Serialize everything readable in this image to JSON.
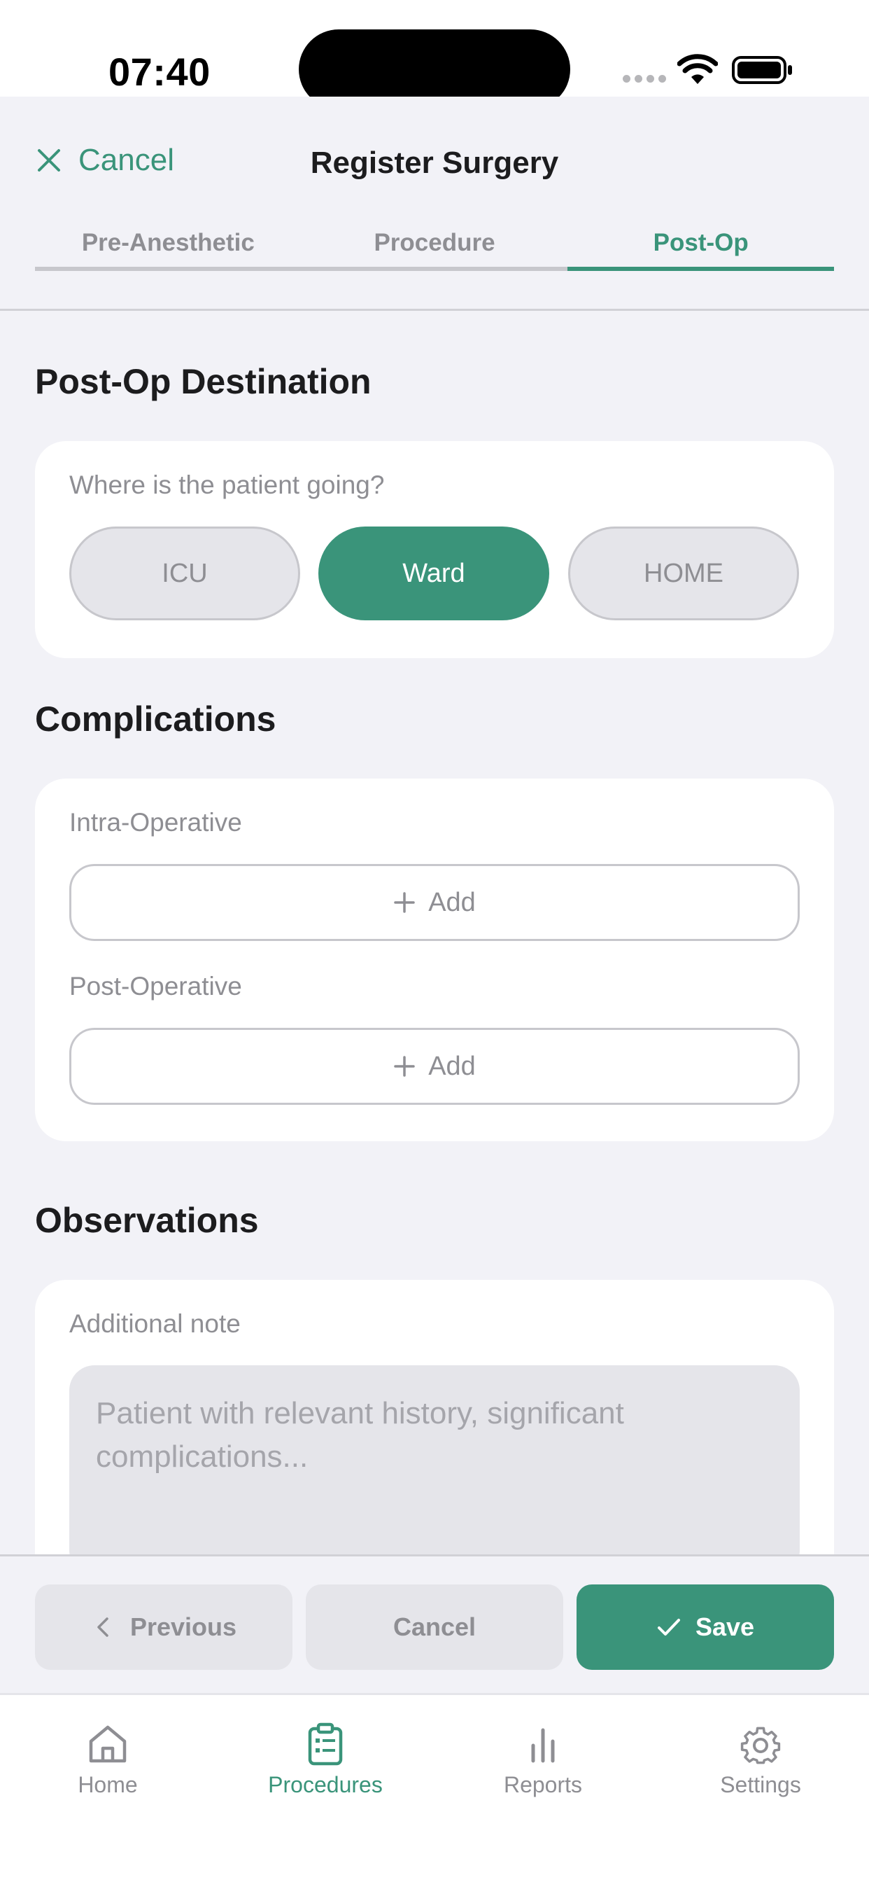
{
  "status_bar": {
    "time": "07:40"
  },
  "header": {
    "cancel_label": "Cancel",
    "title": "Register Surgery",
    "tabs": [
      {
        "label": "Pre-Anesthetic",
        "active": false
      },
      {
        "label": "Procedure",
        "active": false
      },
      {
        "label": "Post-Op",
        "active": true
      }
    ]
  },
  "destination": {
    "section_title": "Post-Op Destination",
    "question": "Where is the patient going?",
    "options": [
      {
        "label": "ICU",
        "selected": false
      },
      {
        "label": "Ward",
        "selected": true
      },
      {
        "label": "HOME",
        "selected": false
      }
    ]
  },
  "complications": {
    "section_title": "Complications",
    "intra_label": "Intra-Operative",
    "intra_add": "Add",
    "post_label": "Post-Operative",
    "post_add": "Add"
  },
  "observations": {
    "section_title": "Observations",
    "note_label": "Additional note",
    "note_placeholder": "Patient with relevant history, significant complications..."
  },
  "actions": {
    "previous": "Previous",
    "cancel": "Cancel",
    "save": "Save"
  },
  "tab_bar": {
    "items": [
      {
        "label": "Home",
        "icon": "home-icon",
        "active": false
      },
      {
        "label": "Procedures",
        "icon": "clipboard-icon",
        "active": true
      },
      {
        "label": "Reports",
        "icon": "bar-chart-icon",
        "active": false
      },
      {
        "label": "Settings",
        "icon": "gear-icon",
        "active": false
      }
    ]
  },
  "colors": {
    "accent": "#3a947a",
    "background": "#f2f2f7",
    "inactive_text": "#8e8e93"
  }
}
